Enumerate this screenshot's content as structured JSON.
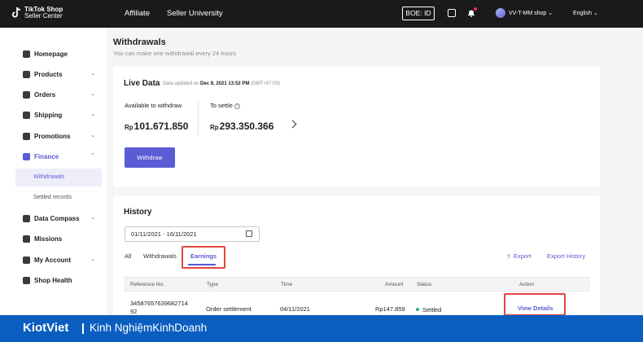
{
  "topbar": {
    "logo_line1": "TikTok Shop",
    "logo_line2": "Seller Center",
    "nav": [
      "Affiliate",
      "Seller University"
    ],
    "boe": "BOE: ID",
    "shop_name": "VV-T-MM shop ⌄",
    "language": "English ⌄"
  },
  "sidebar": {
    "items": [
      {
        "label": "Homepage"
      },
      {
        "label": "Products",
        "chevron": "⌄"
      },
      {
        "label": "Orders",
        "chevron": "⌄"
      },
      {
        "label": "Shipping",
        "chevron": "⌄"
      },
      {
        "label": "Promotions",
        "chevron": "⌄"
      },
      {
        "label": "Finance",
        "chevron": "⌃"
      },
      {
        "label": "Data Compass",
        "chevron": "⌄"
      },
      {
        "label": "Missions"
      },
      {
        "label": "My Account",
        "chevron": "⌄"
      },
      {
        "label": "Shop Health"
      }
    ],
    "finance_sub": [
      "Withdrawals",
      "Settled records"
    ]
  },
  "page": {
    "title": "Withdrawals",
    "subtitle": "You can make one withdrawal every 24 hours"
  },
  "live_data": {
    "title": "Live Data",
    "updated_prefix": "Data updated on",
    "updated_time": "Dec 8, 2021 13:52 PM",
    "updated_tz": "(GMT+07:00)",
    "available_label": "Available to withdraw",
    "available_currency": "Rp",
    "available_amount": "101.671.850",
    "settle_label": "To settle",
    "settle_currency": "Rp",
    "settle_amount": "293.350.366",
    "withdraw_button": "Withdraw",
    "info_glyph": "?"
  },
  "history": {
    "title": "History",
    "date_range": "01/11/2021 - 16/11/2021",
    "tabs": [
      "All",
      "Withdrawals",
      "Earnings"
    ],
    "export_icon": "⇪",
    "export": "Export",
    "export_history": "Export History",
    "columns": [
      "Reference No.",
      "Type",
      "Time",
      "Amount",
      "Status",
      "Action"
    ],
    "rows": [
      {
        "ref_line1": "34587657639682714",
        "ref_line2": "92",
        "type": "Order settlement",
        "time": "04/11/2021",
        "amount": "Rp147.859",
        "status": "Settled",
        "action": "View Details"
      }
    ]
  },
  "banner": {
    "brand": "KiotViet",
    "text": "Kinh NghiệmKinhDoanh"
  },
  "colors": {
    "accent": "#5b5bd6",
    "highlight": "#e2473f",
    "banner": "#0a5ec0",
    "status_green": "#22b573"
  }
}
